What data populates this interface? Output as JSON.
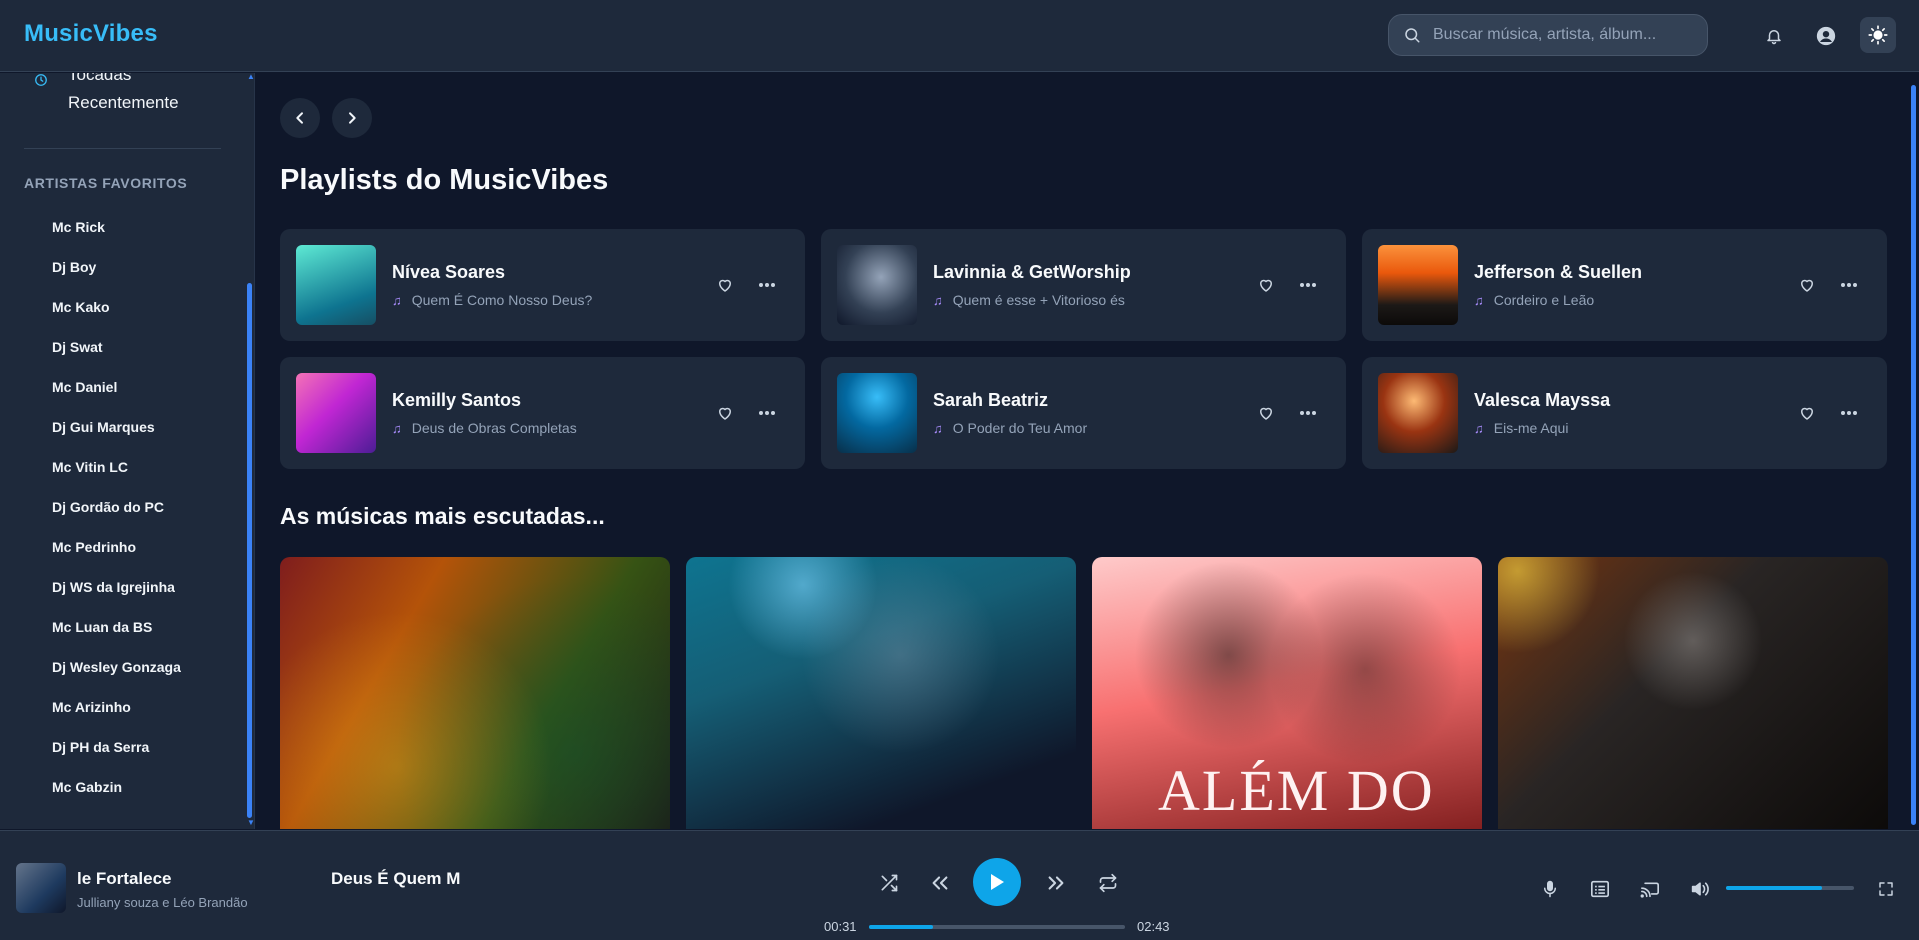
{
  "app": {
    "logo": "MusicVibes",
    "accent": "#38bdf8"
  },
  "header": {
    "search_placeholder": "Buscar música, artista, álbum...",
    "icons": [
      "search-icon",
      "bell-icon",
      "user-icon",
      "sun-icon"
    ]
  },
  "sidebar": {
    "recent_label": "Tocadas Recentemente",
    "favorites_heading": "ARTISTAS FAVORITOS",
    "artists": [
      "Mc Rick",
      "Dj Boy",
      "Mc Kako",
      "Dj Swat",
      "Mc Daniel",
      "Dj Gui Marques",
      "Mc Vitin LC",
      "Dj Gordão do PC",
      "Mc Pedrinho",
      "Dj WS da Igrejinha",
      "Mc Luan da BS",
      "Dj Wesley Gonzaga",
      "Mc Arizinho",
      "Dj PH da Serra",
      "Mc Gabzin"
    ]
  },
  "main": {
    "playlists_title": "Playlists do MusicVibes",
    "playlists": [
      {
        "name": "Nívea Soares",
        "subtitle": "Quem É Como Nosso Deus?",
        "colors": [
          "#2dd4bf",
          "#0e7490"
        ]
      },
      {
        "name": "Lavinnia & GetWorship",
        "subtitle": "Quem é esse + Vitorioso és",
        "colors": [
          "#64748b",
          "#1e293b"
        ]
      },
      {
        "name": "Jefferson & Suellen",
        "subtitle": "Cordeiro e Leão",
        "colors": [
          "#f97316",
          "#1c1917"
        ]
      },
      {
        "name": "Kemilly Santos",
        "subtitle": "Deus de Obras Completas",
        "colors": [
          "#ec4899",
          "#6b21a8"
        ]
      },
      {
        "name": "Sarah Beatriz",
        "subtitle": "O Poder do Teu Amor",
        "colors": [
          "#0284c7",
          "#082f49"
        ]
      },
      {
        "name": "Valesca Mayssa",
        "subtitle": "Eis-me Aqui",
        "colors": [
          "#c2410c",
          "#292524"
        ]
      }
    ],
    "top_title": "As músicas mais escutadas...",
    "top_songs": [
      {
        "colors": [
          "#7f1d1d",
          "#365314"
        ]
      },
      {
        "colors": [
          "#155e75",
          "#0f172a"
        ]
      },
      {
        "colors": [
          "#fca5a5",
          "#7f1d1d"
        ],
        "overlay_text": "ALÉM DO"
      },
      {
        "colors": [
          "#44403c",
          "#0c0a09"
        ]
      }
    ]
  },
  "player": {
    "title": "le Fortalece",
    "artist": "Julliany souza e Léo Brandão",
    "scroll_title": "Deus É Quem M",
    "current_time": "00:31",
    "duration": "02:43",
    "progress": 0.25,
    "volume": 0.75
  }
}
